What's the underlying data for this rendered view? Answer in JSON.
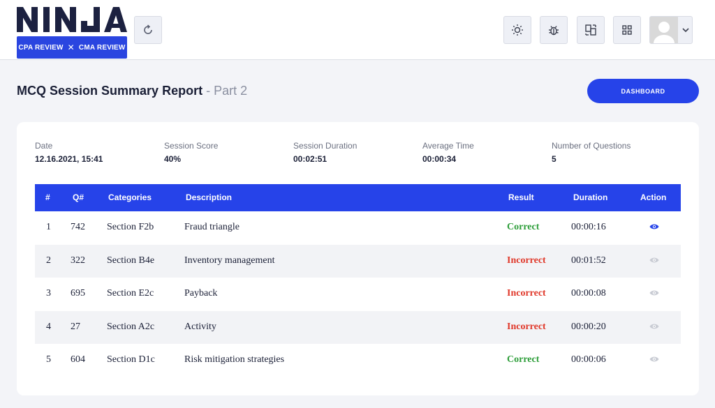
{
  "brand": {
    "logo_text": "NINJA",
    "badge_left": "CPA REVIEW",
    "badge_right": "CMA REVIEW"
  },
  "header": {
    "icons": [
      "refresh-icon",
      "sun-icon",
      "bug-icon",
      "compare-icon",
      "grid-icon",
      "avatar",
      "chevron-down-icon"
    ]
  },
  "page": {
    "title": "MCQ Session Summary Report",
    "separator": " - ",
    "subtitle": "Part 2",
    "dashboard_label": "DASHBOARD"
  },
  "stats": [
    {
      "label": "Date",
      "value": "12.16.2021, 15:41"
    },
    {
      "label": "Session Score",
      "value": "40%"
    },
    {
      "label": "Session Duration",
      "value": "00:02:51"
    },
    {
      "label": "Average Time",
      "value": "00:00:34"
    },
    {
      "label": "Number of Questions",
      "value": "5"
    }
  ],
  "table": {
    "headers": [
      "#",
      "Q#",
      "Categories",
      "Description",
      "Result",
      "Duration",
      "Action"
    ],
    "rows": [
      {
        "num": "1",
        "q": "742",
        "category": "Section F2b",
        "description": "Fraud triangle",
        "result": "Correct",
        "duration": "00:00:16",
        "action_active": true
      },
      {
        "num": "2",
        "q": "322",
        "category": "Section B4e",
        "description": "Inventory management",
        "result": "Incorrect",
        "duration": "00:01:52",
        "action_active": false
      },
      {
        "num": "3",
        "q": "695",
        "category": "Section E2c",
        "description": "Payback",
        "result": "Incorrect",
        "duration": "00:00:08",
        "action_active": false
      },
      {
        "num": "4",
        "q": "27",
        "category": "Section A2c",
        "description": "Activity",
        "result": "Incorrect",
        "duration": "00:00:20",
        "action_active": false
      },
      {
        "num": "5",
        "q": "604",
        "category": "Section D1c",
        "description": "Risk mitigation strategies",
        "result": "Correct",
        "duration": "00:00:06",
        "action_active": false
      }
    ]
  },
  "colors": {
    "primary": "#2643e9",
    "correct": "#2e9e3a",
    "incorrect": "#e0392b",
    "eye_active": "#2643e9",
    "eye_inactive": "#c9ccd4"
  }
}
